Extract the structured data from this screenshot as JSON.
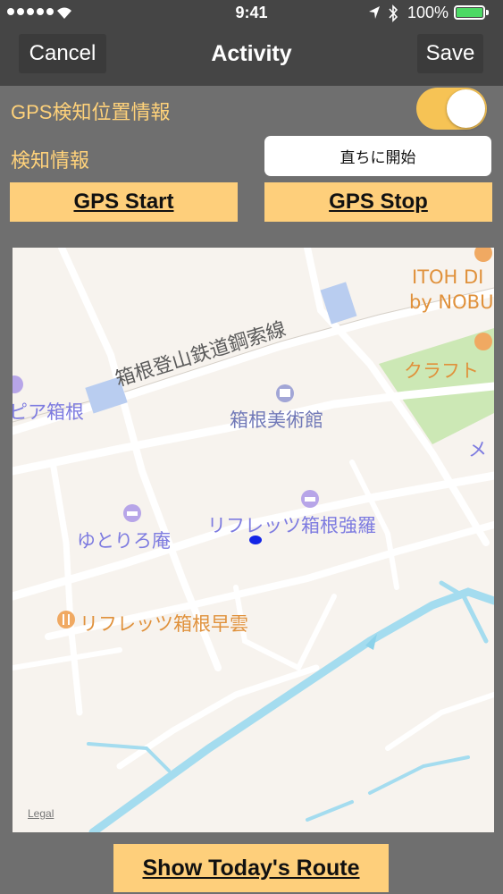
{
  "status_bar": {
    "time": "9:41",
    "battery": "100%"
  },
  "nav": {
    "cancel": "Cancel",
    "title": "Activity",
    "save": "Save"
  },
  "gps_info": {
    "label": "GPS検知位置情報",
    "toggle_on": true
  },
  "detection": {
    "label": "検知情報",
    "value": "直ちに開始"
  },
  "buttons": {
    "start": "GPS Start",
    "stop": "GPS Stop",
    "route": "Show Today's Route"
  },
  "map": {
    "legal": "Legal",
    "labels": {
      "ropeway": "箱根登山鉄道鋼索線",
      "museum": "箱根美術館",
      "refresh_gora": "リフレッツ箱根強羅",
      "yutoriro": "ゆとりろ庵",
      "refresh_hayakumo": "リフレッツ箱根早雲",
      "pia": "ピア箱根",
      "craft": "クラフト",
      "itoh_1": "ITOH DI",
      "itoh_2": "by NOBU",
      "me": "メ"
    }
  },
  "colors": {
    "accent": "#fecf7b",
    "toggle": "#f6c355",
    "label_text": "#ffd27a",
    "poi_blue": "#7d7be0",
    "poi_orange": "#e0913b"
  }
}
